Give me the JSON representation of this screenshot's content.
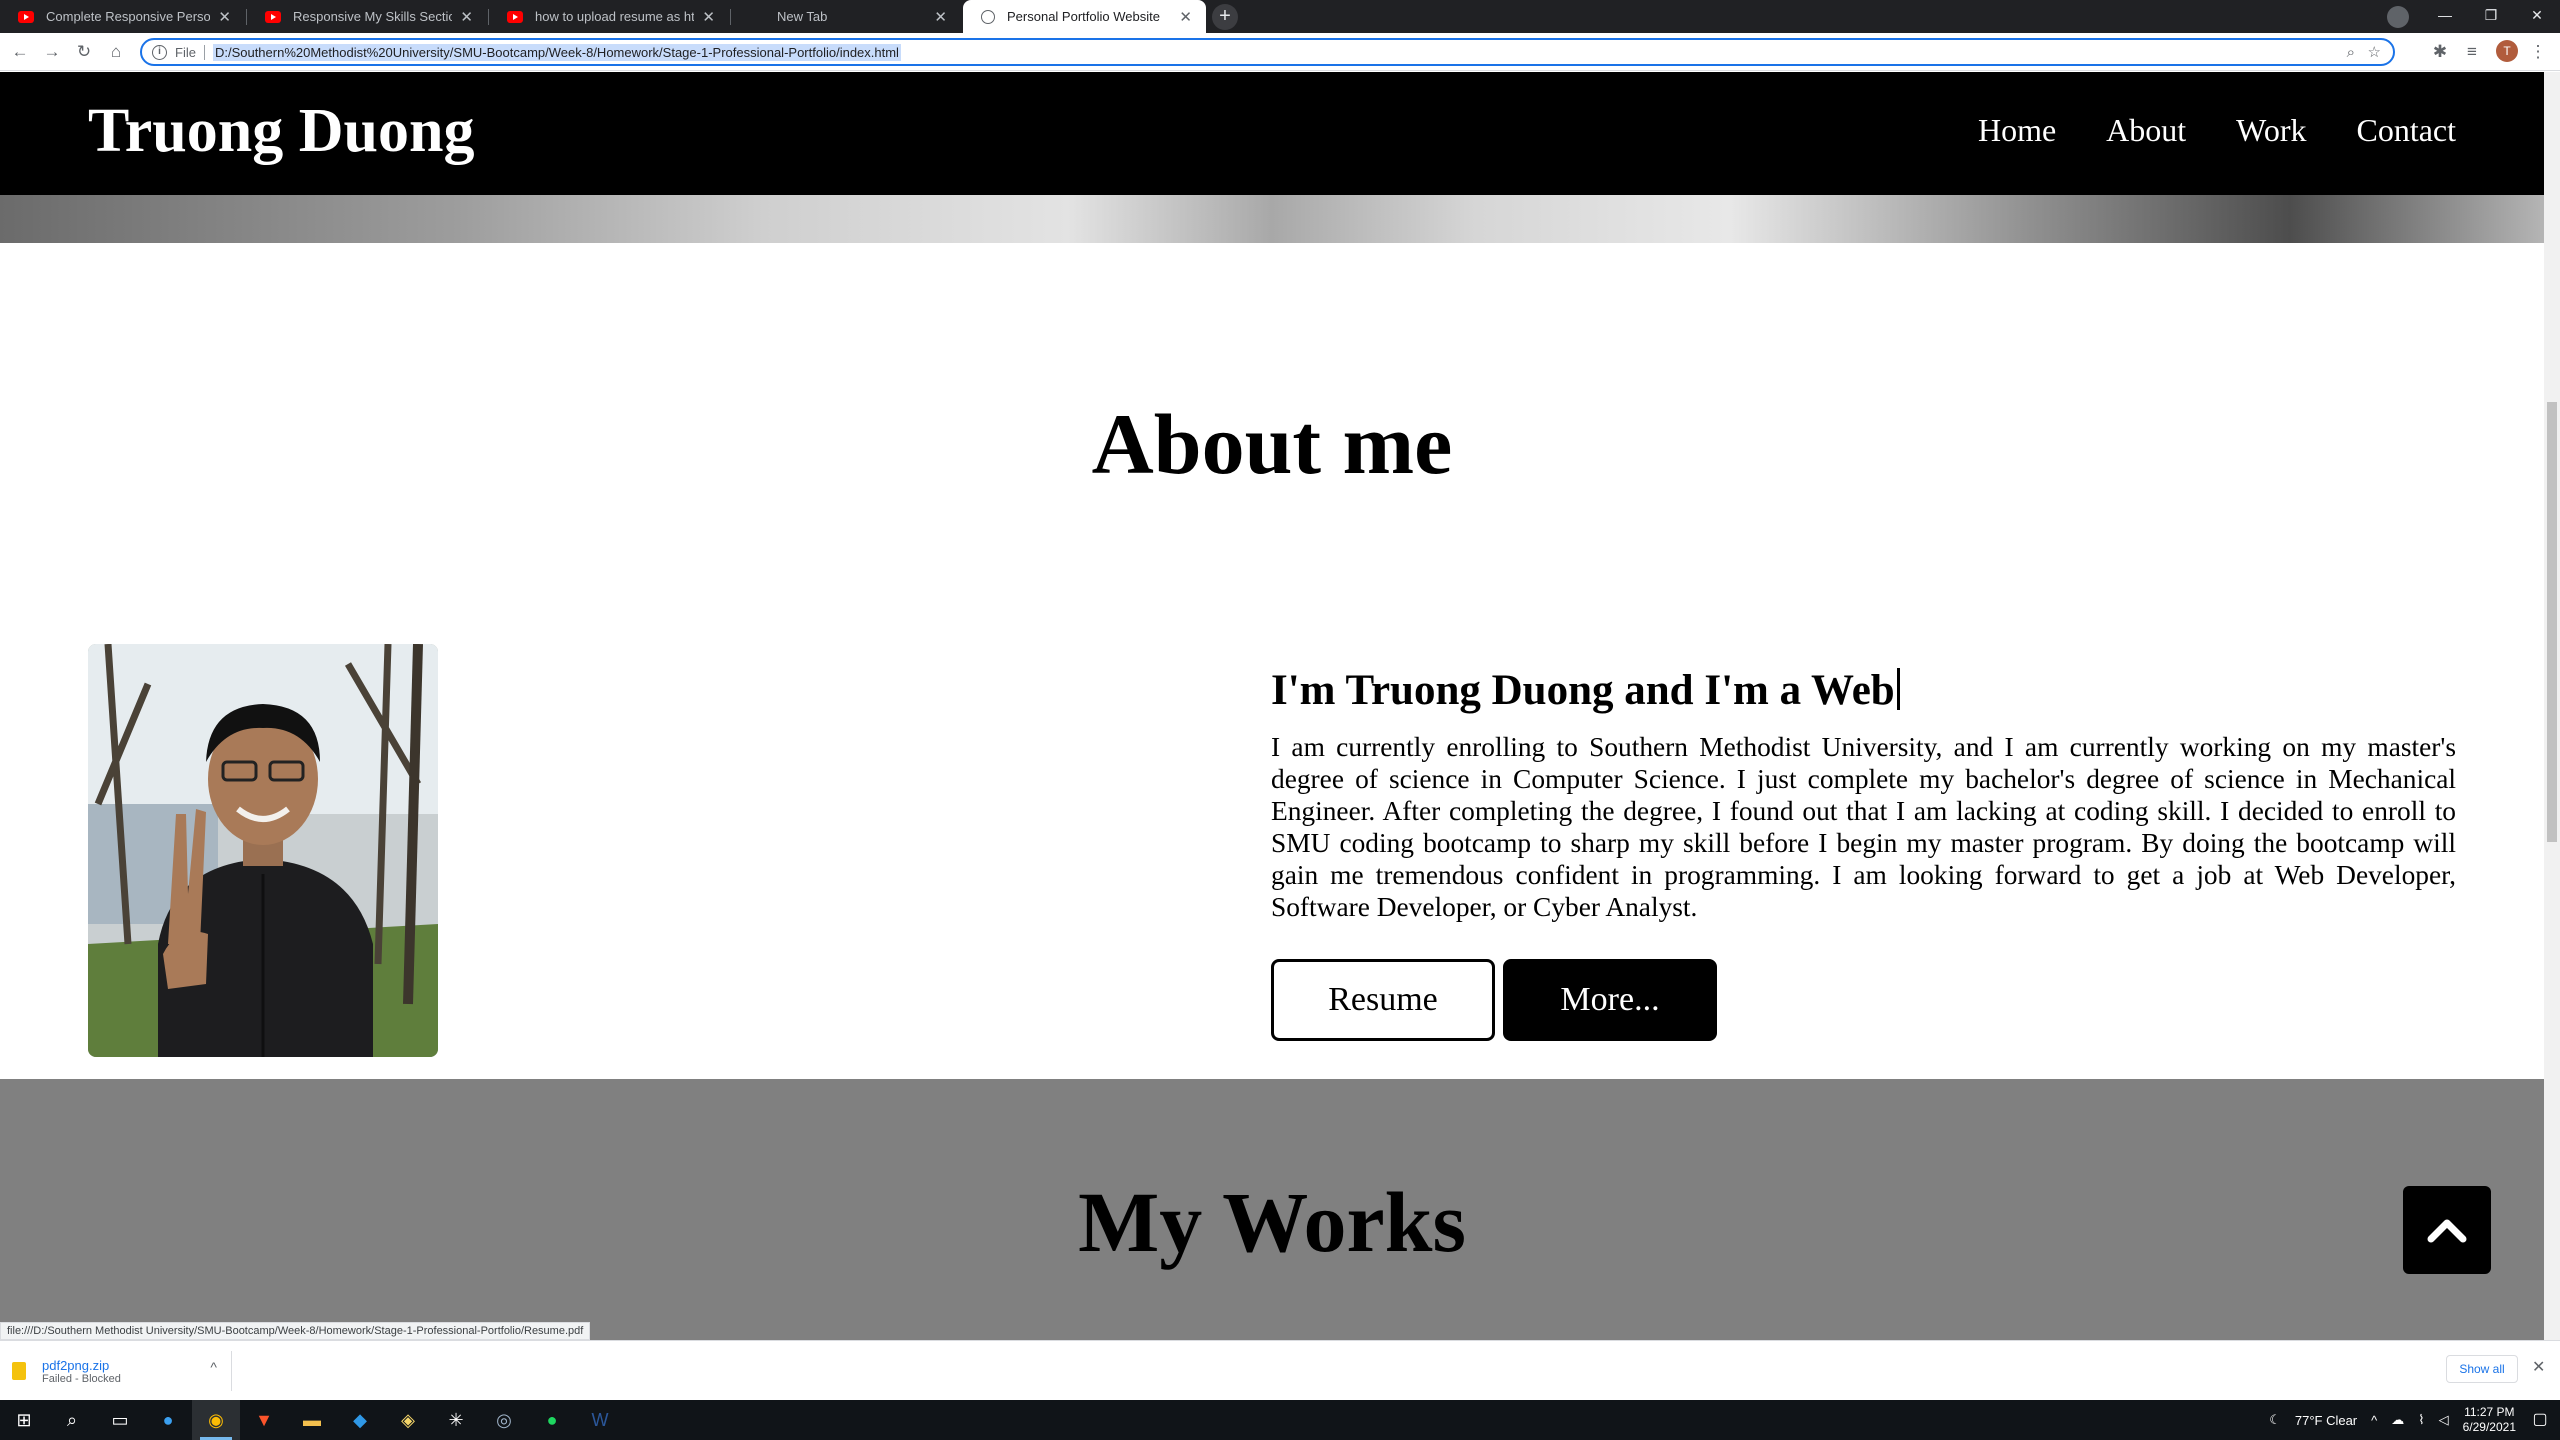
{
  "browser": {
    "tabs": [
      {
        "title": "Complete Responsive Personal P",
        "favicon": "youtube-icon"
      },
      {
        "title": "Responsive My Skills Section Usi",
        "favicon": "youtube-icon"
      },
      {
        "title": "how to upload resume as html",
        "favicon": "youtube-icon"
      },
      {
        "title": "New Tab",
        "favicon": "none"
      },
      {
        "title": "Personal Portfolio Website",
        "favicon": "globe-icon",
        "active": true
      }
    ],
    "close_glyph": "✕",
    "new_tab_glyph": "+",
    "window_controls": {
      "minimize": "—",
      "maximize": "❐",
      "close": "✕"
    },
    "omnibox": {
      "scheme_label": "File",
      "url": "D:/Southern%20Methodist%20University/SMU-Bootcamp/Week-8/Homework/Stage-1-Professional-Portfolio/index.html"
    },
    "profile_initial": "T"
  },
  "site": {
    "brand": "Truong Duong",
    "nav": [
      {
        "label": "Home"
      },
      {
        "label": "About"
      },
      {
        "label": "Work"
      },
      {
        "label": "Contact"
      }
    ],
    "about": {
      "title": "About me",
      "headline": "I'm Truong Duong and I'm a Web",
      "bio": "I am currently enrolling to Southern Methodist University, and I am currently working on my master's degree of science in Computer Science. I just complete my bachelor's degree of science in Mechanical Engineer. After completing the degree, I found out that I am lacking at coding skill. I decided to enroll to SMU coding bootcamp to sharp my skill before I begin my master program. By doing the bootcamp will gain me tremendous confident in programming. I am looking forward to get a job at Web Developer, Software Developer, or Cyber Analyst.",
      "buttons": {
        "resume": "Resume",
        "more": "More..."
      }
    },
    "works": {
      "title": "My Works"
    },
    "back_to_top_icon": "chevron-up-icon"
  },
  "status_bar": {
    "hover_url": "file:///D:/Southern Methodist University/SMU-Bootcamp/Week-8/Homework/Stage-1-Professional-Portfolio/Resume.pdf"
  },
  "downloads": {
    "item": {
      "name": "pdf2png.zip",
      "status": "Failed - Blocked"
    },
    "show_all": "Show all"
  },
  "taskbar": {
    "weather": "77°F  Clear",
    "time": "11:27 PM",
    "date": "6/29/2021"
  }
}
